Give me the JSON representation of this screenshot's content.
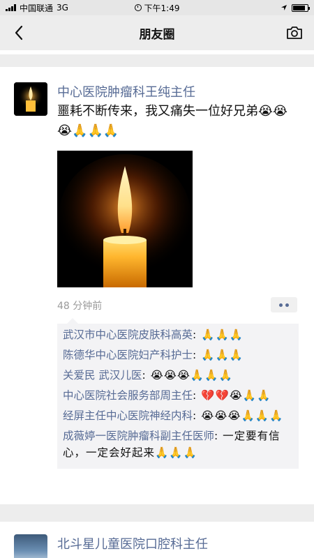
{
  "status_bar": {
    "carrier": "中国联通",
    "network": "3G",
    "time": "下午1:49",
    "battery_level": 0.85
  },
  "nav": {
    "title": "朋友圈"
  },
  "post": {
    "author": "中心医院肿瘤科王纯主任",
    "text": "噩耗不断传来，我又痛失一位好兄弟😭😭😭🙏🙏🙏",
    "timestamp": "48 分钟前",
    "comments": [
      {
        "name": "武汉市中心医院皮肤科高英",
        "text": ": 🙏🙏🙏"
      },
      {
        "name": "陈德华中心医院妇产科护士",
        "text": ": 🙏🙏🙏"
      },
      {
        "name": "关爱民 武汉儿医",
        "text": ": 😭😭😭🙏🙏🙏"
      },
      {
        "name": "中心医院社会服务部周主任",
        "text": ": 💔💔😭🙏🙏"
      },
      {
        "name": "经屏主任中心医院神经内科",
        "text": ": 😭😭😭🙏🙏🙏"
      },
      {
        "name": "成薇婷一医院肿瘤科副主任医师",
        "text": ": 一定要有信心，一定会好起来🙏🙏🙏"
      }
    ]
  },
  "next_post": {
    "author": "北斗星儿童医院口腔科主任"
  },
  "colors": {
    "link": "#576b95",
    "background": "#ededed",
    "comment_bg": "#f3f3f5",
    "timestamp": "#9a9a9a"
  },
  "icons": {
    "back": "chevron-left-icon",
    "camera": "camera-icon",
    "more": "more-dots-icon",
    "location": "location-arrow-icon",
    "alarm": "alarm-icon"
  }
}
